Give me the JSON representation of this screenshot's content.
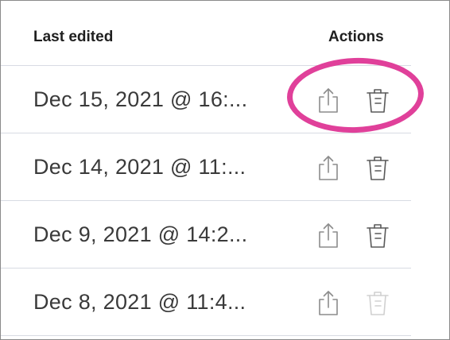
{
  "table": {
    "headers": {
      "last_edited": "Last edited",
      "actions": "Actions"
    },
    "rows": [
      {
        "date": "Dec 15, 2021 @ 16:...",
        "trash_enabled": true
      },
      {
        "date": "Dec 14, 2021 @ 11:...",
        "trash_enabled": true
      },
      {
        "date": "Dec 9, 2021 @ 14:2...",
        "trash_enabled": true
      },
      {
        "date": "Dec 8, 2021 @ 11:4...",
        "trash_enabled": false
      }
    ]
  },
  "icons": {
    "share": "share-icon",
    "trash": "trash-icon"
  },
  "colors": {
    "highlight": "#e0409a",
    "icon": "#8c8c8c",
    "divider": "#d8dbe3"
  }
}
